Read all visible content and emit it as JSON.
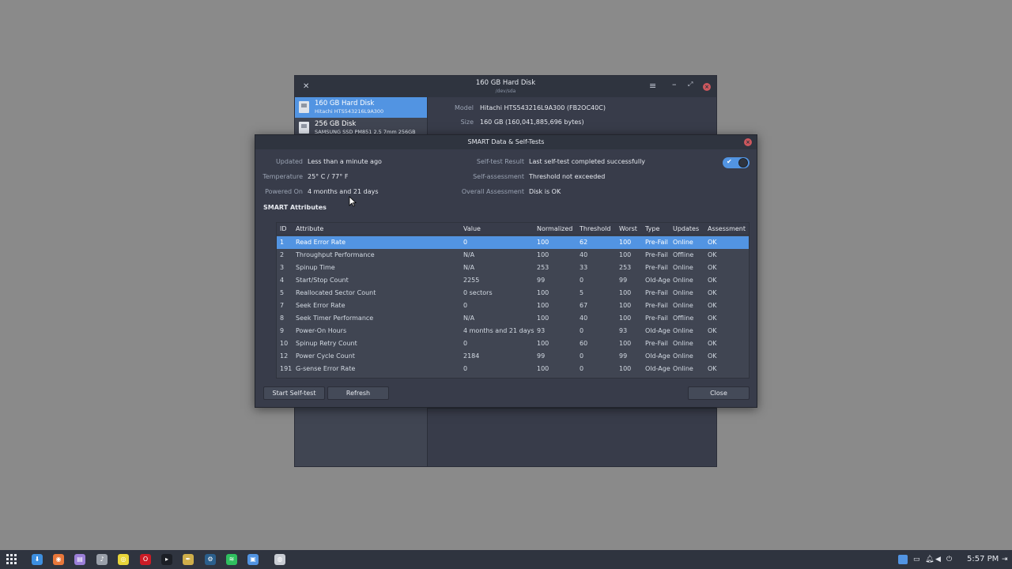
{
  "bg_window": {
    "title": "160 GB Hard Disk",
    "subtitle": "/dev/sda",
    "disks": [
      {
        "name": "160 GB Hard Disk",
        "model": "Hitachi HTS543216L9A300"
      },
      {
        "name": "256 GB Disk",
        "model": "SAMSUNG SSD PM851 2.5 7mm 256GB"
      }
    ],
    "info": {
      "model_label": "Model",
      "model_value": "Hitachi HTS543216L9A300 (FB2OC40C)",
      "size_label": "Size",
      "size_value": "160 GB (160,041,885,696 bytes)"
    }
  },
  "dialog": {
    "title": "SMART Data & Self-Tests",
    "left": [
      {
        "label": "Updated",
        "value": "Less than a minute ago"
      },
      {
        "label": "Temperature",
        "value": "25° C / 77° F"
      },
      {
        "label": "Powered On",
        "value": "4 months and 21 days"
      }
    ],
    "right": [
      {
        "label": "Self-test Result",
        "value": "Last self-test completed successfully"
      },
      {
        "label": "Self-assessment",
        "value": "Threshold not exceeded"
      },
      {
        "label": "Overall Assessment",
        "value": "Disk is OK"
      }
    ],
    "toggle_on": true,
    "section_title": "SMART Attributes",
    "columns": [
      "ID",
      "Attribute",
      "Value",
      "Normalized",
      "Threshold",
      "Worst",
      "Type",
      "Updates",
      "Assessment"
    ],
    "rows": [
      [
        "1",
        "Read Error Rate",
        "0",
        "100",
        "62",
        "100",
        "Pre-Fail",
        "Online",
        "OK"
      ],
      [
        "2",
        "Throughput Performance",
        "N/A",
        "100",
        "40",
        "100",
        "Pre-Fail",
        "Offline",
        "OK"
      ],
      [
        "3",
        "Spinup Time",
        "N/A",
        "253",
        "33",
        "253",
        "Pre-Fail",
        "Online",
        "OK"
      ],
      [
        "4",
        "Start/Stop Count",
        "2255",
        "99",
        "0",
        "99",
        "Old-Age",
        "Online",
        "OK"
      ],
      [
        "5",
        "Reallocated Sector Count",
        "0 sectors",
        "100",
        "5",
        "100",
        "Pre-Fail",
        "Online",
        "OK"
      ],
      [
        "7",
        "Seek Error Rate",
        "0",
        "100",
        "67",
        "100",
        "Pre-Fail",
        "Online",
        "OK"
      ],
      [
        "8",
        "Seek Timer Performance",
        "N/A",
        "100",
        "40",
        "100",
        "Pre-Fail",
        "Offline",
        "OK"
      ],
      [
        "9",
        "Power-On Hours",
        "4 months and 21 days",
        "93",
        "0",
        "93",
        "Old-Age",
        "Online",
        "OK"
      ],
      [
        "10",
        "Spinup Retry Count",
        "0",
        "100",
        "60",
        "100",
        "Pre-Fail",
        "Online",
        "OK"
      ],
      [
        "12",
        "Power Cycle Count",
        "2184",
        "99",
        "0",
        "99",
        "Old-Age",
        "Online",
        "OK"
      ],
      [
        "191",
        "G-sense Error Rate",
        "0",
        "100",
        "0",
        "100",
        "Old-Age",
        "Online",
        "OK"
      ]
    ],
    "buttons": {
      "start": "Start Self-test",
      "refresh": "Refresh",
      "close": "Close"
    }
  },
  "taskbar": {
    "apps": [
      {
        "icon": "download-icon",
        "glyph": "⬇",
        "color": "#3d8fe0"
      },
      {
        "icon": "firefox-icon",
        "glyph": "◉",
        "color": "#e8773a"
      },
      {
        "icon": "files-icon",
        "glyph": "▤",
        "color": "#9b7fd8"
      },
      {
        "icon": "music-icon",
        "glyph": "♪",
        "color": "#9aa0aa"
      },
      {
        "icon": "disc-icon",
        "glyph": "◎",
        "color": "#e8d53a"
      },
      {
        "icon": "opera-icon",
        "glyph": "O",
        "color": "#cc1b25"
      },
      {
        "icon": "terminal-icon",
        "glyph": "▸",
        "color": "#1c1f26"
      },
      {
        "icon": "inkscape-icon",
        "glyph": "✒",
        "color": "#cfae4a"
      },
      {
        "icon": "steam-icon",
        "glyph": "⚙",
        "color": "#2b5f8c"
      },
      {
        "icon": "spotify-icon",
        "glyph": "≋",
        "color": "#2fbf5f"
      },
      {
        "icon": "disks-icon",
        "glyph": "▣",
        "color": "#5294e2"
      },
      {
        "icon": "settings-icon",
        "glyph": "◍",
        "color": "#c8ccd3"
      }
    ],
    "clock": "5:57 PM"
  }
}
